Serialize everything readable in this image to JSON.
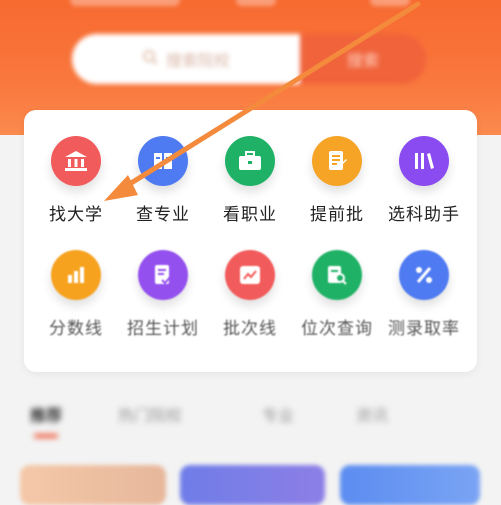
{
  "hero": {
    "search_placeholder": "搜索院校",
    "search_button": "搜索"
  },
  "tools_row1": [
    {
      "label": "找大学",
      "icon": "university-icon",
      "color": "#f25b5b"
    },
    {
      "label": "查专业",
      "icon": "book-icon",
      "color": "#4f7bf2"
    },
    {
      "label": "看职业",
      "icon": "briefcase-icon",
      "color": "#1fb266"
    },
    {
      "label": "提前批",
      "icon": "document-edit-icon",
      "color": "#f6a426"
    },
    {
      "label": "选科助手",
      "icon": "books-icon",
      "color": "#8a4bf0"
    }
  ],
  "tools_row2": [
    {
      "label": "分数线",
      "icon": "bar-chart-icon",
      "color": "#f7a21f"
    },
    {
      "label": "招生计划",
      "icon": "checklist-icon",
      "color": "#9450ef"
    },
    {
      "label": "批次线",
      "icon": "line-chart-icon",
      "color": "#f25b5b"
    },
    {
      "label": "位次查询",
      "icon": "search-document-icon",
      "color": "#1fb266"
    },
    {
      "label": "测录取率",
      "icon": "percent-icon",
      "color": "#4f7bf2"
    }
  ],
  "tabs": [
    "推荐",
    "热门院校",
    "专业",
    "资讯"
  ],
  "colors": {
    "hero": "#f76a30",
    "annotation_arrow": "#f48a3c",
    "tab_accent": "#f05a3a"
  }
}
